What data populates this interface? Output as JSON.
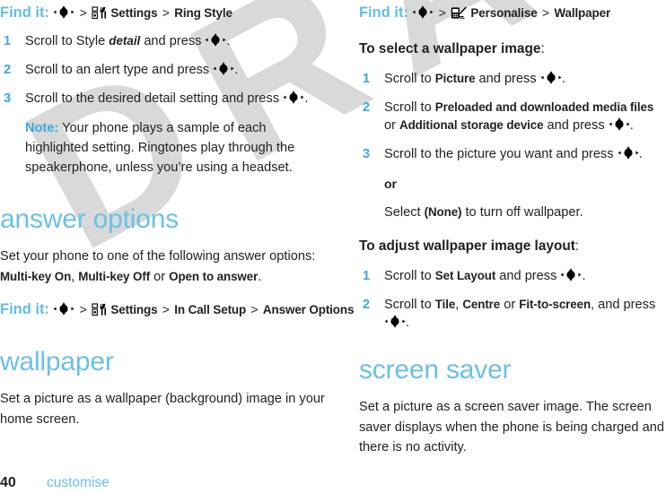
{
  "document": {
    "watermark": "DRAFT",
    "page_number": "40",
    "chapter": "customise",
    "accent_blue": "#6cc0ea",
    "step_number_blue": "#3aa7e0",
    "text_black": "#231f20"
  },
  "left_column": {
    "findit_ringstyle": {
      "label": "Find it:",
      "sep": ">",
      "nav_icon": "nav-key-icon",
      "settings_icon": "settings-tools-icon",
      "item1": "Settings",
      "item2": "Ring Style"
    },
    "steps": [
      {
        "num": "1",
        "parts": [
          {
            "t": "Scroll to Style ",
            "s": "plain"
          },
          {
            "t": "detail",
            "s": "ital"
          },
          {
            "t": " and press ",
            "s": "plain"
          },
          {
            "t": "nav-key-icon",
            "s": "icon"
          },
          {
            "t": ".",
            "s": "plain"
          }
        ]
      },
      {
        "num": "2",
        "parts": [
          {
            "t": "Scroll to an alert type and press ",
            "s": "plain"
          },
          {
            "t": "nav-key-icon",
            "s": "icon"
          },
          {
            "t": ".",
            "s": "plain"
          }
        ]
      },
      {
        "num": "3",
        "parts": [
          {
            "t": "Scroll to the desired detail setting and press ",
            "s": "plain"
          },
          {
            "t": "nav-key-icon",
            "s": "icon"
          },
          {
            "t": ".",
            "s": "plain"
          }
        ]
      }
    ],
    "note": {
      "label": "Note:",
      "text": " Your phone plays a sample of each highlighted setting. Ringtones play through the speakerphone, unless you’re using a headset."
    },
    "answer_options": {
      "heading": "answer options",
      "body_pre": "Set your phone to one of the following answer options: ",
      "option1": "Multi-key On",
      "comma": ", ",
      "option2": "Multi-key Off",
      "or": " or ",
      "option3": "Open to answer",
      "body_post": "."
    },
    "findit_answer": {
      "label": "Find it:",
      "sep": ">",
      "nav_icon": "nav-key-icon",
      "settings_icon": "settings-tools-icon",
      "item1": "Settings",
      "item2": "In Call Setup",
      "item3": "Answer Options"
    },
    "wallpaper": {
      "heading": "wallpaper",
      "body": "Set a picture as a wallpaper (background) image in your home screen."
    }
  },
  "right_column": {
    "findit_wallpaper": {
      "label": "Find it:",
      "sep": ">",
      "nav_icon": "nav-key-icon",
      "personalise_icon": "personalise-phone-pencil-icon",
      "item1": "Personalise",
      "item2": "Wallpaper"
    },
    "select_image": {
      "heading_bold": "To select a wallpaper image",
      "heading_colon": ":",
      "steps": [
        {
          "num": "1",
          "parts": [
            {
              "t": "Scroll to ",
              "s": "plain"
            },
            {
              "t": "Picture",
              "s": "term"
            },
            {
              "t": " and press ",
              "s": "plain"
            },
            {
              "t": "nav-key-icon",
              "s": "icon"
            },
            {
              "t": ".",
              "s": "plain"
            }
          ]
        },
        {
          "num": "2",
          "parts": [
            {
              "t": "Scroll to ",
              "s": "plain"
            },
            {
              "t": "Preloaded and downloaded media files",
              "s": "term"
            },
            {
              "t": " or ",
              "s": "plain"
            },
            {
              "t": "Additional storage device",
              "s": "term"
            },
            {
              "t": " and press ",
              "s": "plain"
            },
            {
              "t": "nav-key-icon",
              "s": "icon"
            },
            {
              "t": ".",
              "s": "plain"
            }
          ]
        },
        {
          "num": "3",
          "parts": [
            {
              "t": "Scroll to the picture you want and press ",
              "s": "plain"
            },
            {
              "t": "nav-key-icon",
              "s": "icon"
            },
            {
              "t": ".",
              "s": "plain"
            }
          ]
        }
      ],
      "or_label": "or",
      "none_pre": "Select ",
      "none_term": "(None)",
      "none_post": " to turn off wallpaper."
    },
    "adjust_layout": {
      "heading_bold": "To adjust wallpaper image layout",
      "heading_colon": ":",
      "steps": [
        {
          "num": "1",
          "parts": [
            {
              "t": "Scroll to ",
              "s": "plain"
            },
            {
              "t": "Set Layout",
              "s": "term"
            },
            {
              "t": " and press ",
              "s": "plain"
            },
            {
              "t": "nav-key-icon",
              "s": "icon"
            },
            {
              "t": ".",
              "s": "plain"
            }
          ]
        },
        {
          "num": "2",
          "parts": [
            {
              "t": "Scroll to ",
              "s": "plain"
            },
            {
              "t": "Tile",
              "s": "term"
            },
            {
              "t": ", ",
              "s": "plain"
            },
            {
              "t": "Centre",
              "s": "term"
            },
            {
              "t": " or ",
              "s": "plain"
            },
            {
              "t": "Fit-to-screen",
              "s": "term"
            },
            {
              "t": ", and press ",
              "s": "plain"
            },
            {
              "t": "nav-key-icon",
              "s": "icon"
            },
            {
              "t": ".",
              "s": "plain"
            }
          ]
        }
      ]
    },
    "screen_saver": {
      "heading": "screen saver",
      "body": "Set a picture as a screen saver image. The screen saver displays when the phone is being charged and there is no activity."
    }
  }
}
